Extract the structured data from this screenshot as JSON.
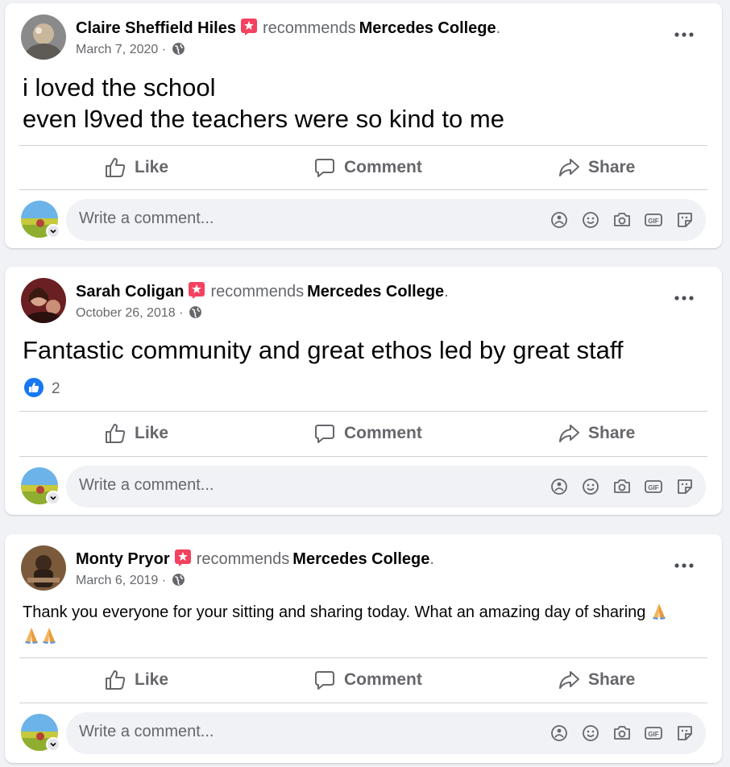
{
  "posts": [
    {
      "author": "Claire Sheffield Hiles",
      "verb": "recommends",
      "page": "Mercedes College",
      "date": "March 7, 2020",
      "date_sep": "·",
      "text_lines": [
        "i loved the school",
        "even l9ved the teachers were so kind to me"
      ]
    },
    {
      "author": "Sarah Coligan",
      "verb": "recommends",
      "page": "Mercedes College",
      "date": "October 26, 2018",
      "date_sep": "·",
      "text_lines": [
        "Fantastic community and great ethos led by great staff"
      ],
      "reaction_count": "2"
    },
    {
      "author": "Monty Pryor",
      "verb": "recommends",
      "page": "Mercedes College",
      "date": "March 6, 2019",
      "date_sep": "·",
      "text": "Thank you everyone for your sitting and sharing today. What an amazing day of sharing"
    }
  ],
  "actions": {
    "like": "Like",
    "comment": "Comment",
    "share": "Share"
  },
  "composer": {
    "placeholder": "Write a comment..."
  },
  "page_period": ".",
  "icons": {
    "recommend_badge": "star-badge-icon",
    "audience": "globe-icon",
    "more": "more-options-icon",
    "like": "thumbs-up-icon",
    "comment": "speech-bubble-icon",
    "share": "share-arrow-icon",
    "emoji": "smiley-icon",
    "camera": "camera-icon",
    "gif": "gif-icon",
    "sticker": "sticker-icon",
    "avatar_text": "avatar-frame-icon",
    "reaction": "like-reaction-icon",
    "pray": "folded-hands-emoji"
  },
  "colors": {
    "background": "#f0f2f5",
    "card": "#ffffff",
    "secondary_text": "#65676b",
    "badge": "#f3425f",
    "like_blue": "#1877f2",
    "divider": "#ced0d4"
  }
}
